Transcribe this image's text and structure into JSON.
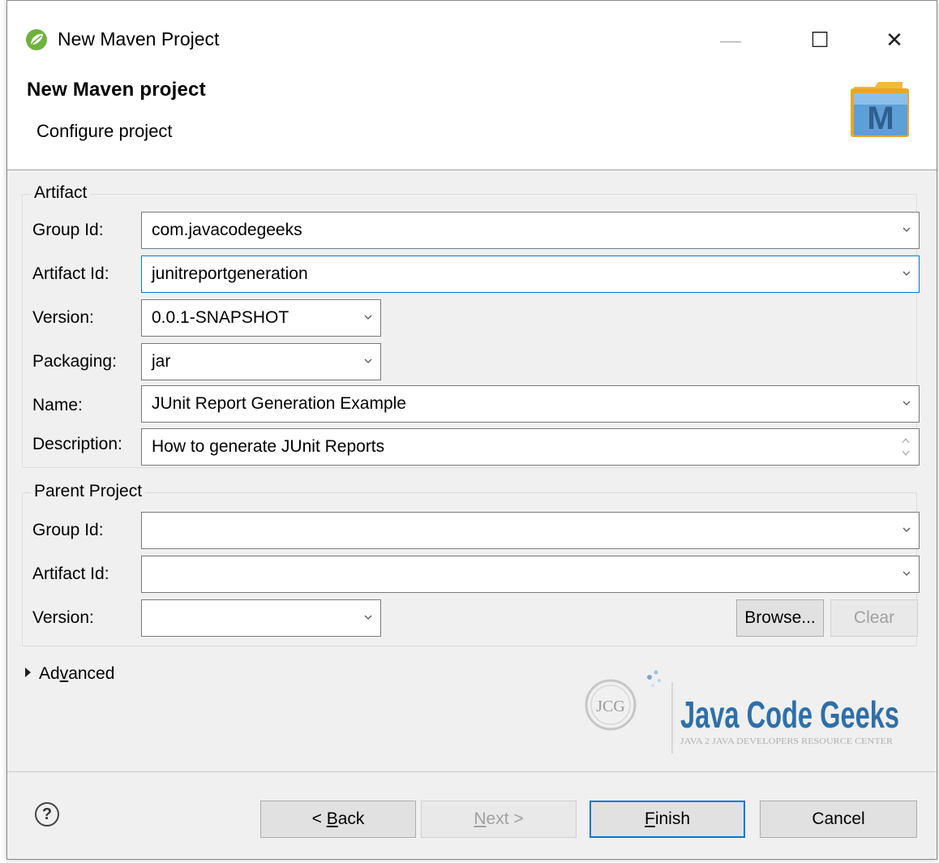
{
  "window": {
    "title": "New Maven Project",
    "minimize_glyph": "—",
    "maximize_glyph": "☐",
    "close_glyph": "✕"
  },
  "header": {
    "title": "New Maven project",
    "subtitle": "Configure project",
    "logo_letter": "M"
  },
  "artifact": {
    "group_label": "Artifact",
    "group_id": {
      "label": "Group Id:",
      "value": "com.javacodegeeks"
    },
    "artifact_id": {
      "label": "Artifact Id:",
      "value": "junitreportgeneration"
    },
    "version": {
      "label": "Version:",
      "value": "0.0.1-SNAPSHOT"
    },
    "packaging": {
      "label": "Packaging:",
      "value": "jar"
    },
    "name": {
      "label": "Name:",
      "value": "JUnit Report Generation Example"
    },
    "description": {
      "label": "Description:",
      "value": "How to generate JUnit Reports"
    }
  },
  "parent": {
    "group_label": "Parent Project",
    "group_id": {
      "label": "Group Id:",
      "value": ""
    },
    "artifact_id": {
      "label": "Artifact Id:",
      "value": ""
    },
    "version": {
      "label": "Version:",
      "value": ""
    },
    "browse_label": "Browse...",
    "clear_label": "Clear"
  },
  "advanced": {
    "label_pre": "Ad",
    "label_mnemonic": "v",
    "label_post": "anced"
  },
  "watermark": {
    "badge": "JCG",
    "brand": "Java Code Geeks",
    "tagline": "JAVA 2 JAVA DEVELOPERS RESOURCE CENTER"
  },
  "footer": {
    "help_glyph": "?",
    "back": {
      "pre": "< ",
      "mnemonic": "B",
      "post": "ack"
    },
    "next": {
      "mnemonic": "N",
      "post": "ext >"
    },
    "finish": {
      "mnemonic": "F",
      "post": "inish"
    },
    "cancel": "Cancel"
  },
  "colors": {
    "accent": "#0078d7",
    "maven_blue": "#4a90c8",
    "spring_green": "#6db33f"
  }
}
